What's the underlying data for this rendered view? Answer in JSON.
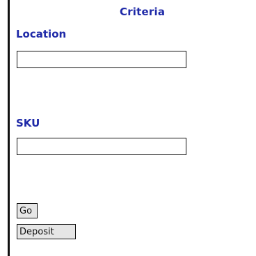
{
  "form": {
    "title": "Criteria",
    "location": {
      "label": "Location",
      "value": "",
      "placeholder": ""
    },
    "sku": {
      "label": "SKU",
      "value": "",
      "placeholder": ""
    }
  },
  "actions": {
    "go_label": "Go",
    "deposit_label": "Deposit"
  },
  "colors": {
    "label_text": "#1f2aa8",
    "button_face": "#e6e6e6",
    "border": "#111111"
  }
}
